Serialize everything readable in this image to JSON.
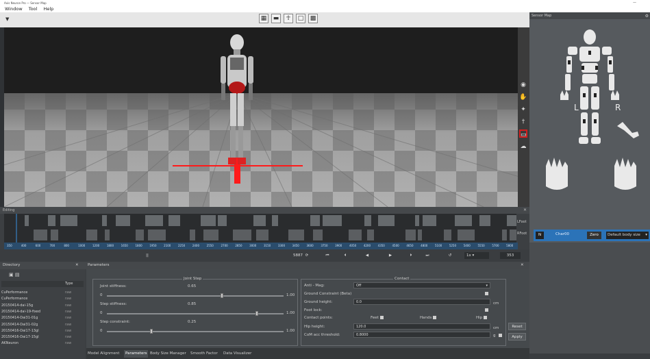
{
  "titlebar": {
    "title": "Axis Neuron Pro  —  Sensor Map",
    "right": "—"
  },
  "menubar": {
    "items": [
      "Window",
      "Tool",
      "Help"
    ]
  },
  "viewport": {
    "toolbar_icons": [
      "checker-icon",
      "camera-icon",
      "figure-icon",
      "square-icon",
      "checker-alt-icon"
    ],
    "right_icons": [
      "ring-icon",
      "hand-icon",
      "figure-walk-icon",
      "stand-icon",
      "ruler-icon",
      "cloud-icon"
    ]
  },
  "sensor_map": {
    "title": "Sensor Map",
    "left_label": "L",
    "right_label": "R",
    "character": {
      "n_badge": "N",
      "name": "Char00",
      "zero_label": "Zero",
      "body_size": "Default body size"
    }
  },
  "timeline": {
    "title": "Editing",
    "tracks": [
      "LFoot",
      "RFoot"
    ],
    "ruler_ticks": [
      "350",
      "400",
      "600",
      "700",
      "800",
      "1000",
      "1200",
      "1800",
      "1650",
      "1800",
      "1950",
      "2100",
      "2250",
      "2400",
      "2550",
      "2700",
      "2850",
      "3000",
      "3150",
      "3300",
      "3450",
      "3600",
      "3750",
      "3900",
      "4050",
      "4200",
      "4350",
      "4500",
      "4650",
      "4800",
      "5100",
      "5250",
      "5400",
      "5550",
      "5700",
      "5800"
    ],
    "frame": "5887",
    "speed": "1x",
    "current": "353",
    "pause": "||"
  },
  "directory": {
    "title": "Directory",
    "type_header": "Type",
    "items": [
      {
        "name": "CuPerformance",
        "type": "raw"
      },
      {
        "name": "CuPerformance",
        "type": "raw"
      },
      {
        "name": "20150414-dai-15g",
        "type": "raw"
      },
      {
        "name": "20150414-dai-19-fixed",
        "type": "raw"
      },
      {
        "name": "20150414-Dai31-01g",
        "type": "raw"
      },
      {
        "name": "20150414-Dai31-02g",
        "type": "raw"
      },
      {
        "name": "20150416-Dai17-13gl",
        "type": "raw"
      },
      {
        "name": "20150416-Dai17-15gl",
        "type": "raw"
      },
      {
        "name": "AKNeuron",
        "type": "raw"
      }
    ]
  },
  "parameters": {
    "title": "Parameters",
    "joint_step": {
      "title": "Joint  Step",
      "rows": [
        {
          "label": "Joint stiffness:",
          "value": "0.65",
          "min": "0",
          "max": "1.00",
          "frac": 0.65
        },
        {
          "label": "Step stiffness:",
          "value": "0.85",
          "min": "0",
          "max": "1.00",
          "frac": 0.85
        },
        {
          "label": "Step constraint:",
          "value": "0.25",
          "min": "0",
          "max": "1.00",
          "frac": 0.25
        }
      ]
    },
    "contact": {
      "title": "Contact",
      "anti_mag_label": "Anti - Mag:",
      "anti_mag_value": "Off",
      "ground_constraint_label": "Ground Constraint (Beta)",
      "ground_height_label": "Ground height:",
      "ground_height_value": "0.0",
      "ground_height_unit": "cm",
      "foot_lock_label": "Foot lock:",
      "contact_points_label": "Contact points:",
      "feet_label": "Feet",
      "hands_label": "Hands",
      "hip_label": "Hip",
      "hip_height_label": "Hip height:",
      "hip_height_value": "120.0",
      "hip_height_unit": "cm",
      "com_label": "CoM acc threshold:",
      "com_value": "0.8000",
      "com_unit": "g",
      "reset": "Reset",
      "apply": "Apply"
    }
  },
  "tabs": [
    "Model Alignment",
    "Parameters",
    "Body Size Manager",
    "Smooth Factor",
    "Data Visualizer"
  ],
  "active_tab": "Parameters"
}
